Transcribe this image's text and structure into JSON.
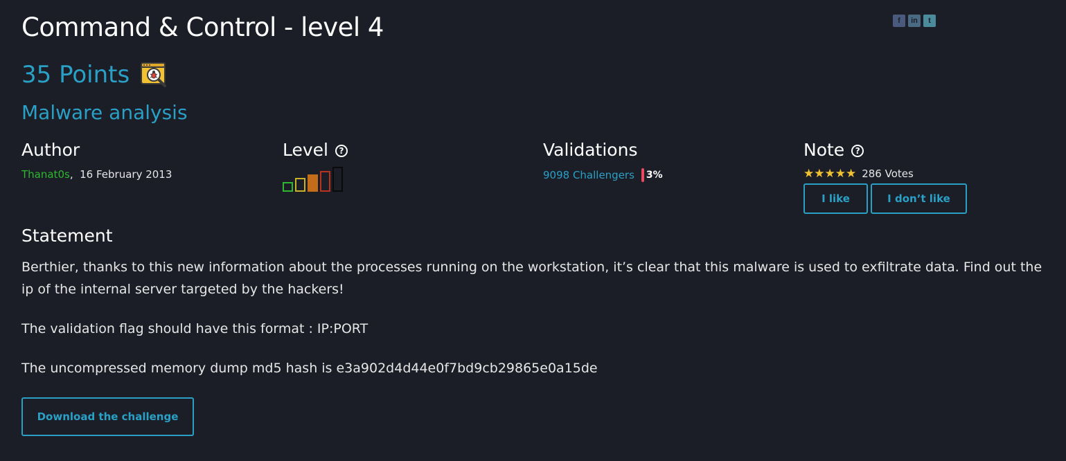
{
  "challenge": {
    "title": "Command & Control - level 4",
    "points": "35 Points",
    "category": "Malware analysis",
    "category_icon": "bug-magnifier-icon"
  },
  "social": {
    "facebook": "f",
    "linkedin": "in",
    "twitter": "t"
  },
  "author": {
    "heading": "Author",
    "name": "Thanat0s",
    "date": "16 February 2013"
  },
  "level": {
    "heading": "Level",
    "current": 4,
    "max": 5
  },
  "validations": {
    "heading": "Validations",
    "challengers": "9098 Challengers",
    "percent": "3%"
  },
  "note": {
    "heading": "Note",
    "stars": "★★★★★",
    "rating": 5,
    "votes": "286 Votes",
    "like_label": "I like",
    "dislike_label": "I don’t like"
  },
  "statement": {
    "heading": "Statement",
    "paragraph1": "Berthier, thanks to this new information about the processes running on the workstation, it’s clear that this malware is used to exfiltrate data. Find out the ip of the internal server targeted by the hackers!",
    "paragraph2": "The validation flag should have this format : IP:PORT",
    "paragraph3": "The uncompressed memory dump md5 hash is e3a902d4d44e0f7bd9cb29865e0a15de"
  },
  "download_label": "Download the challenge",
  "colors": {
    "accent": "#2aa0c6",
    "author_link": "#2fb82f",
    "stars": "#f2c233",
    "percent_bar": "#e84a5f",
    "background": "#1b1e26"
  }
}
